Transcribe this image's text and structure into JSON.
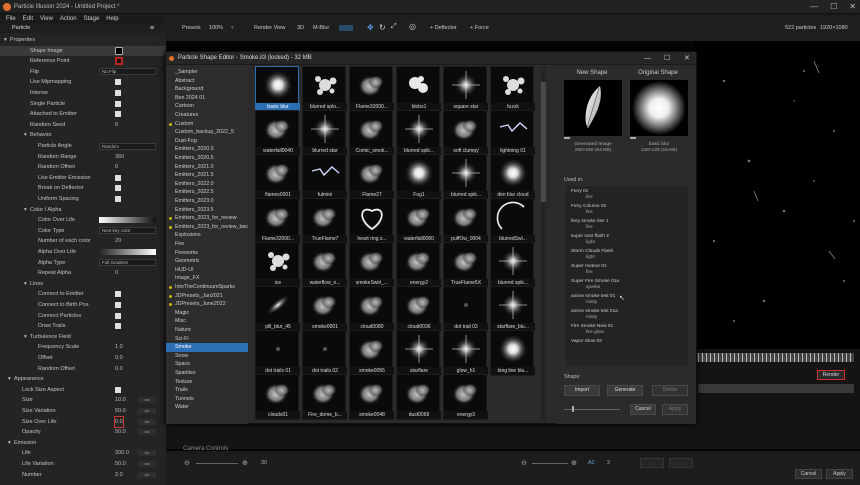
{
  "app": {
    "title": "Particle Illusion 2024 - Untitled Project *",
    "menu": [
      "File",
      "Edit",
      "View",
      "Action",
      "Stage",
      "Help"
    ]
  },
  "toolbar": {
    "presets": "Presets",
    "zoom": "100%",
    "render_view": "Render View",
    "view3d": "3D",
    "mblur": "M-Blur",
    "deflector": "+ Deflector",
    "force": "+ Force",
    "particles": "522 particles",
    "resolution": "1920×1080"
  },
  "left_panel": {
    "header": "Particle",
    "rows": [
      {
        "label": "Properties",
        "indent": 10,
        "kind": "section"
      },
      {
        "label": "Shape Image",
        "indent": 30,
        "kind": "swatch",
        "sel": true
      },
      {
        "label": "Reference Point",
        "indent": 30,
        "kind": "redswatch"
      },
      {
        "label": "Flip",
        "indent": 30,
        "kind": "dropdown",
        "value": "No Flip"
      },
      {
        "label": "Use Mipmapping",
        "indent": 30,
        "kind": "check"
      },
      {
        "label": "Intense",
        "indent": 30,
        "kind": "check"
      },
      {
        "label": "Single Particle",
        "indent": 30,
        "kind": "check"
      },
      {
        "label": "Attached to Emitter",
        "indent": 30,
        "kind": "check"
      },
      {
        "label": "Random Seed",
        "indent": 30,
        "kind": "value",
        "value": "0"
      },
      {
        "label": "Behavior",
        "indent": 30,
        "kind": "section"
      },
      {
        "label": "Particle Angle",
        "indent": 38,
        "kind": "dropdown",
        "value": "Random"
      },
      {
        "label": "Random Range",
        "indent": 38,
        "kind": "value",
        "value": "360"
      },
      {
        "label": "Random Offset",
        "indent": 38,
        "kind": "value",
        "value": "0"
      },
      {
        "label": "Use Emitter Emission",
        "indent": 38,
        "kind": "check"
      },
      {
        "label": "Break on Deflector",
        "indent": 38,
        "kind": "check"
      },
      {
        "label": "Uniform Spacing",
        "indent": 38,
        "kind": "check"
      },
      {
        "label": "Color / Alpha",
        "indent": 30,
        "kind": "section"
      },
      {
        "label": "Color Over Life",
        "indent": 38,
        "kind": "gradient"
      },
      {
        "label": "Color Type",
        "indent": 38,
        "kind": "dropdown",
        "value": "Next key color"
      },
      {
        "label": "Number of each color",
        "indent": 38,
        "kind": "value",
        "value": "20"
      },
      {
        "label": "Alpha Over Life",
        "indent": 38,
        "kind": "gradient2"
      },
      {
        "label": "Alpha Type",
        "indent": 38,
        "kind": "dropdown",
        "value": "Full Gradient"
      },
      {
        "label": "Repeat Alpha",
        "indent": 38,
        "kind": "value",
        "value": "0"
      },
      {
        "label": "Lines",
        "indent": 30,
        "kind": "section"
      },
      {
        "label": "Connect to Emitter",
        "indent": 38,
        "kind": "check"
      },
      {
        "label": "Connect to Birth Pos.",
        "indent": 38,
        "kind": "check"
      },
      {
        "label": "Connect Particles",
        "indent": 38,
        "kind": "check"
      },
      {
        "label": "Draw Trails",
        "indent": 38,
        "kind": "check"
      },
      {
        "label": "Turbulence Field",
        "indent": 30,
        "kind": "section"
      },
      {
        "label": "Frequency Scale",
        "indent": 38,
        "kind": "value",
        "value": "1.0"
      },
      {
        "label": "Offset",
        "indent": 38,
        "kind": "value",
        "value": "0.0"
      },
      {
        "label": "Random Offset",
        "indent": 38,
        "kind": "value",
        "value": "0.0"
      },
      {
        "label": "Appearance",
        "indent": 14,
        "kind": "section"
      },
      {
        "label": "Lock Size Aspect",
        "indent": 22,
        "kind": "check"
      },
      {
        "label": "Size",
        "indent": 22,
        "kind": "spin",
        "value": "10.0"
      },
      {
        "label": "Size Variation",
        "indent": 22,
        "kind": "spin",
        "value": "50.0"
      },
      {
        "label": "Size Over Life",
        "indent": 22,
        "kind": "spin",
        "value": "0.0"
      },
      {
        "label": "Opacity",
        "indent": 22,
        "kind": "spin",
        "value": "50.0"
      },
      {
        "label": "Emission",
        "indent": 14,
        "kind": "section"
      },
      {
        "label": "Life",
        "indent": 22,
        "kind": "spin",
        "value": "200.0"
      },
      {
        "label": "Life Variation",
        "indent": 22,
        "kind": "spin",
        "value": "50.0"
      },
      {
        "label": "Number",
        "indent": 22,
        "kind": "spin",
        "value": "2.0"
      }
    ]
  },
  "dialog": {
    "title": "Particle Shape Editor - Smoke.il3 (locked) - 32 MB",
    "categories": [
      {
        "name": "_Sampler",
        "dot": false
      },
      {
        "name": "Abstract",
        "dot": false
      },
      {
        "name": "Background",
        "dot": false
      },
      {
        "name": "Ben 2024 01",
        "dot": false
      },
      {
        "name": "Cartoon",
        "dot": false
      },
      {
        "name": "Creatures",
        "dot": false
      },
      {
        "name": "Custom",
        "dot": true
      },
      {
        "name": "Custom_backup_2022_5",
        "dot": false
      },
      {
        "name": "Dust-Fog",
        "dot": false
      },
      {
        "name": "Emitters_2020.0",
        "dot": false
      },
      {
        "name": "Emitters_2020.5",
        "dot": false
      },
      {
        "name": "Emitters_2021.0",
        "dot": false
      },
      {
        "name": "Emitters_2021.5",
        "dot": false
      },
      {
        "name": "Emitters_2022.0",
        "dot": false
      },
      {
        "name": "Emitters_2022.5",
        "dot": false
      },
      {
        "name": "Emitters_2023.0",
        "dot": false
      },
      {
        "name": "Emitters_2023.5",
        "dot": false
      },
      {
        "name": "Emitters_2023_for_review",
        "dot": true
      },
      {
        "name": "Emitters_2023_for_review_bac",
        "dot": true
      },
      {
        "name": "Explosions",
        "dot": false
      },
      {
        "name": "Fire",
        "dot": false
      },
      {
        "name": "Fireworks",
        "dot": false
      },
      {
        "name": "Geometric",
        "dot": false
      },
      {
        "name": "HUD-UI",
        "dot": false
      },
      {
        "name": "Image_FX",
        "dot": false
      },
      {
        "name": "IntoTheContinuumSparks",
        "dot": true
      },
      {
        "name": "JDPresets_Jan2021",
        "dot": true
      },
      {
        "name": "JDPresets_June2022",
        "dot": true
      },
      {
        "name": "Magic",
        "dot": false
      },
      {
        "name": "Misc",
        "dot": false
      },
      {
        "name": "Nature",
        "dot": false
      },
      {
        "name": "Sci-Fi",
        "dot": false
      },
      {
        "name": "Smoke",
        "dot": false,
        "sel": true
      },
      {
        "name": "Snow",
        "dot": false
      },
      {
        "name": "Space",
        "dot": false
      },
      {
        "name": "Sparkles",
        "dot": false
      },
      {
        "name": "Texture",
        "dot": false
      },
      {
        "name": "Trails",
        "dot": false
      },
      {
        "name": "Tunnels",
        "dot": false
      },
      {
        "name": "Water",
        "dot": false
      }
    ],
    "shapes": [
      {
        "name": "basic blur",
        "type": "blur",
        "sel": true
      },
      {
        "name": "blurred splo...",
        "type": "splat"
      },
      {
        "name": "Flame32000...",
        "type": "smoke"
      },
      {
        "name": "blobs1",
        "type": "blob"
      },
      {
        "name": "square star",
        "type": "star"
      },
      {
        "name": "fuzzk",
        "type": "splat"
      },
      {
        "name": "waterfall0040",
        "type": "smoke"
      },
      {
        "name": "blurred star",
        "type": "star"
      },
      {
        "name": "Comic_smok...",
        "type": "smoke"
      },
      {
        "name": "blurred spik...",
        "type": "star"
      },
      {
        "name": "soft clumpy",
        "type": "smoke"
      },
      {
        "name": "lightning 01",
        "type": "lightning"
      },
      {
        "name": "flames0001",
        "type": "smoke"
      },
      {
        "name": "fulmini",
        "type": "lightning"
      },
      {
        "name": "Flame27",
        "type": "smoke"
      },
      {
        "name": "Fog1",
        "type": "blur"
      },
      {
        "name": "blurred spik...",
        "type": "star"
      },
      {
        "name": "dim blur cloud",
        "type": "blur"
      },
      {
        "name": "Flame32000...",
        "type": "smoke"
      },
      {
        "name": "TrueFlame7",
        "type": "smoke"
      },
      {
        "name": "heart ring s...",
        "type": "ring"
      },
      {
        "name": "waterfall0080",
        "type": "smoke"
      },
      {
        "name": "puffOw_0004",
        "type": "smoke"
      },
      {
        "name": "blurredSwi...",
        "type": "arc"
      },
      {
        "name": "ice",
        "type": "splat"
      },
      {
        "name": "waterflow_n...",
        "type": "smoke"
      },
      {
        "name": "smokeSwirl_...",
        "type": "smoke"
      },
      {
        "name": "energy2",
        "type": "smoke"
      },
      {
        "name": "TrueFlame5X",
        "type": "smoke"
      },
      {
        "name": "blurred spik...",
        "type": "star"
      },
      {
        "name": "pill_blur_45",
        "type": "pill"
      },
      {
        "name": "smoke0001",
        "type": "smoke"
      },
      {
        "name": "cloud0080",
        "type": "smoke"
      },
      {
        "name": "cloud0036",
        "type": "smoke"
      },
      {
        "name": "dot trail 03",
        "type": "dim"
      },
      {
        "name": "starflare_blu...",
        "type": "star"
      },
      {
        "name": "dot trails 01",
        "type": "dim"
      },
      {
        "name": "dot trails 02",
        "type": "dim"
      },
      {
        "name": "smoke0055",
        "type": "smoke"
      },
      {
        "name": "starflare",
        "type": "star"
      },
      {
        "name": "glow_h1",
        "type": "star"
      },
      {
        "name": "long line blu...",
        "type": "blur"
      },
      {
        "name": "clouds01",
        "type": "smoke"
      },
      {
        "name": "Fire_dome_b...",
        "type": "smoke"
      },
      {
        "name": "smoke0048",
        "type": "smoke"
      },
      {
        "name": "dust0069",
        "type": "smoke"
      },
      {
        "name": "energy3",
        "type": "smoke"
      }
    ],
    "new_shape_label": "New Shape",
    "original_shape_label": "Original Shape",
    "new_info": [
      "Generated Image",
      "256×256 (64 KB)"
    ],
    "orig_info": [
      "basic blur",
      "128×128 (16 KB)"
    ],
    "used_in_label": "Used in:",
    "used_in": [
      {
        "name": "Fiery 01",
        "sub": "fire"
      },
      {
        "name": "Fiery Column 02",
        "sub": "fire"
      },
      {
        "name": "fiery smoke rise 1",
        "sub": "fire"
      },
      {
        "name": "super soot flash 2",
        "sub": "light"
      },
      {
        "name": "Storm Clouds Flash",
        "sub": "light"
      },
      {
        "name": "Super meteor 01",
        "sub": "fire"
      },
      {
        "name": "Super Fire Smoke 01a",
        "sub": "sparks"
      },
      {
        "name": "anime smoke test 01",
        "sub": "misty"
      },
      {
        "name": "anime smoke test 01a",
        "sub": "misty"
      },
      {
        "name": "Fire Smoke New 01",
        "sub": "fire glow"
      },
      {
        "name": "Vapor Slow 02",
        "sub": ""
      }
    ],
    "shape_label": "Shape:",
    "import": "Import",
    "generate": "Generate",
    "delete": "Delete",
    "cancel": "Cancel",
    "apply": "Apply"
  },
  "render_button": "Render",
  "camera_controls": "Camera Controls",
  "bottom": {
    "fps": "30",
    "range": "A2",
    "frame": "2",
    "cancel": "Cancel",
    "apply": "Apply"
  }
}
